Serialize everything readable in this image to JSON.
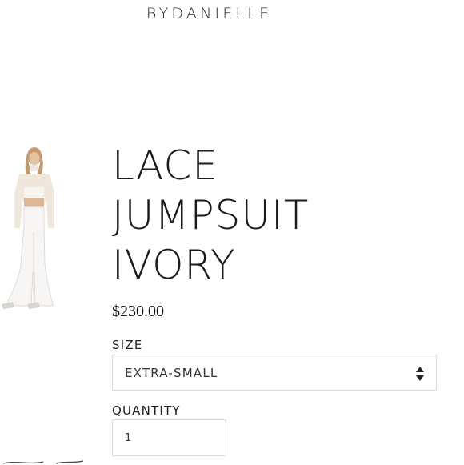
{
  "brand": {
    "wordmark": "BYDANIELLE"
  },
  "product": {
    "title_lines": [
      "LACE",
      "JUMPSUIT",
      "IVORY"
    ],
    "price": "$230.00"
  },
  "size": {
    "label": "SIZE",
    "selected": "EXTRA-SMALL"
  },
  "quantity": {
    "label": "QUANTITY",
    "value": "1"
  },
  "icons": {
    "select_arrows": "updown-arrows-icon",
    "logo": "brand-logo"
  },
  "colors": {
    "text": "#222222",
    "border": "#d9d9d9",
    "background": "#ffffff"
  }
}
